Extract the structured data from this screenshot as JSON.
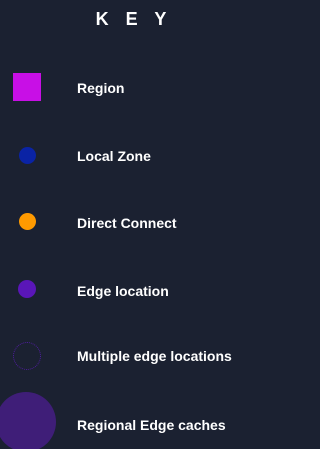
{
  "key": {
    "title": "K E Y",
    "items": [
      {
        "label": "Region",
        "symbol": "square",
        "color": "#c80fe6"
      },
      {
        "label": "Local Zone",
        "symbol": "circle",
        "color": "#0a23a5"
      },
      {
        "label": "Direct Connect",
        "symbol": "circle",
        "color": "#ff9a00"
      },
      {
        "label": "Edge location",
        "symbol": "circle",
        "color": "#5a16b8"
      },
      {
        "label": "Multiple edge locations",
        "symbol": "dotted-circle",
        "color": "#4f1e9e"
      },
      {
        "label": "Regional Edge caches",
        "symbol": "large-circle",
        "color": "#3f1e78"
      }
    ]
  },
  "colors": {
    "background": "#1b2131",
    "text": "#ffffff"
  }
}
